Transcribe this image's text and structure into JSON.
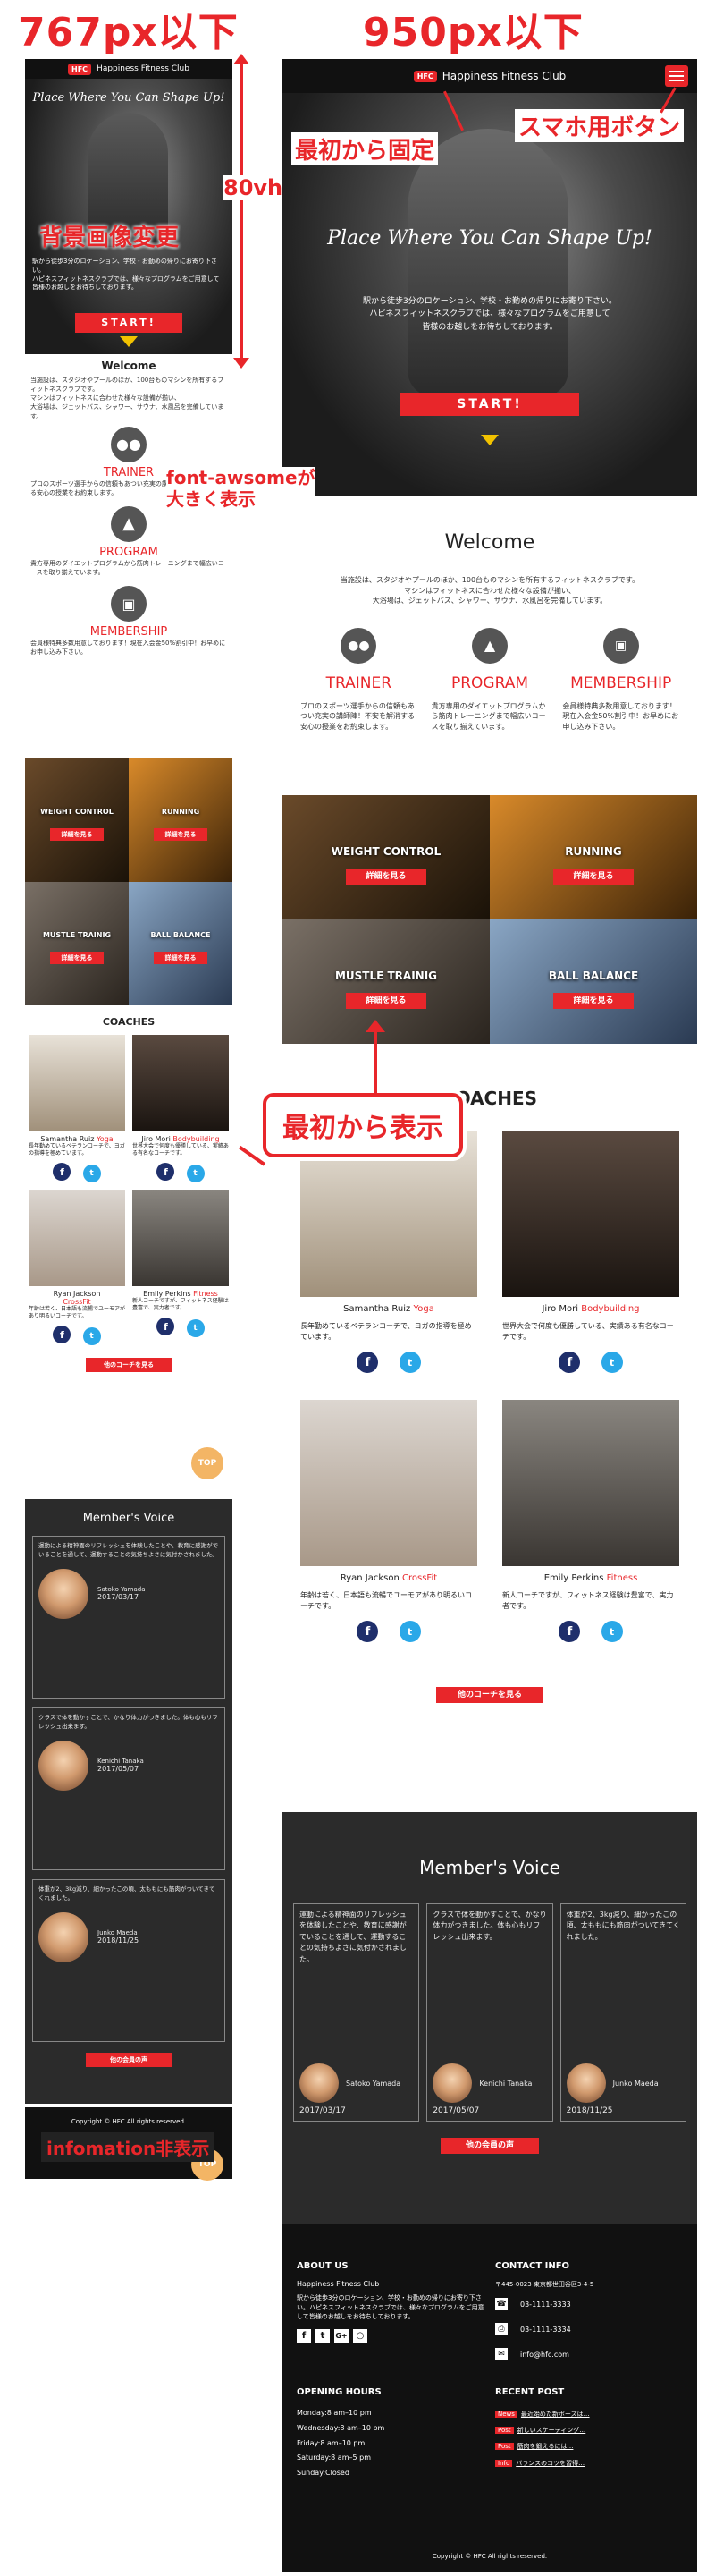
{
  "annotations": {
    "left_width": "767px以下",
    "right_width": "950px以下",
    "hero_height": "80vh",
    "bg_change": "背景画像変更",
    "fixed_header": "最初から固定",
    "sp_button": "スマホ用ボタン",
    "icon_large_1": "font-awsomeが",
    "icon_large_2": "大きく表示",
    "show_first": "最初から表示",
    "info_hidden": "infomation非表示"
  },
  "brand": {
    "badge": "HFC",
    "name": "Happiness Fitness Club"
  },
  "hero": {
    "tagline": "Place Where You Can Shape Up!",
    "text_1": "駅から徒歩3分のロケーション、学校・お勤めの帰りにお寄り下さい。",
    "text_2": "ハピネスフィットネスクラブでは、様々なプログラムをご用意して",
    "text_3": "皆様のお越しをお待ちしております。",
    "start": "START!"
  },
  "welcome": {
    "title": "Welcome",
    "text_1": "当施設は、スタジオやプールのほか、100台ものマシンを所有するフィットネスクラブです。",
    "text_2": "マシンはフィットネスに合わせた様々な設備が揃い、",
    "text_3": "大浴場は、ジェットバス、シャワー、サウナ、水風呂を完備しています。"
  },
  "features": [
    {
      "label": "TRAINER",
      "icon": "users-icon",
      "text": "プロのスポーツ選手からの信頼もあつい充実の講師陣！不安を解消する安心の授業をお約束します。"
    },
    {
      "label": "PROGRAM",
      "icon": "thumbs-up-icon",
      "text": "貴方専用のダイエットプログラムから筋肉トレーニングまで幅広いコースを取り揃えています。"
    },
    {
      "label": "MEMBERSHIP",
      "icon": "id-card-icon",
      "text": "会員様特典多数用意しております！現在入会金50%割引中！お早めにお申し込み下さい。"
    }
  ],
  "tiles": [
    {
      "label": "WEIGHT CONTROL",
      "button": "詳細を見る",
      "c1": "#6a4a2a",
      "c2": "#1a1208"
    },
    {
      "label": "RUNNING",
      "button": "詳細を見る",
      "c1": "#d98a2a",
      "c2": "#3a2208"
    },
    {
      "label": "MUSTLE TRAINIG",
      "button": "詳細を見る",
      "c1": "#7a7066",
      "c2": "#2a241e"
    },
    {
      "label": "BALL BALANCE",
      "button": "詳細を見る",
      "c1": "#8aa6c4",
      "c2": "#2a3a52"
    }
  ],
  "coaches_title": "COACHES",
  "coaches": [
    {
      "name": "Samantha Ruiz",
      "tag": "Yoga",
      "text": "長年勤めているベテランコーチで、ヨガの指導を極めています。",
      "c1": "#e8e2d8",
      "c2": "#a0907a"
    },
    {
      "name": "Jiro Mori",
      "tag": "Bodybuilding",
      "text": "世界大会で何度も優勝している、実績ある有名なコーチです。",
      "c1": "#5a4a40",
      "c2": "#1a1410"
    },
    {
      "name": "Ryan Jackson",
      "tag": "CrossFit",
      "text": "年齢は若く、日本語も流暢でユーモアがあり明るいコーチです。",
      "c1": "#dcd6d0",
      "c2": "#a89888"
    },
    {
      "name": "Emily Perkins",
      "tag": "Fitness",
      "text": "新人コーチですが、フィットネス経験は豊富で、実力者です。",
      "c1": "#8a8680",
      "c2": "#3a3632"
    }
  ],
  "coaches_more": "他のコーチを見る",
  "top_label": "TOP",
  "voice": {
    "title": "Member's Voice",
    "more": "他の会員の声",
    "items": [
      {
        "text": "運動による精神面のリフレッシュを体験したことや、教育に感謝がでいることを通して、運動することの気持ちよさに気付かされました。",
        "name": "Satoko Yamada",
        "date": "2017/03/17"
      },
      {
        "text": "クラスで体を動かすことで、かなり体力がつきました。体も心もリフレッシュ出来ます。",
        "name": "Kenichi Tanaka",
        "date": "2017/05/07"
      },
      {
        "text": "体重が2、3kg減り、細かったこの頃、太ももにも筋肉がついてきてくれました。",
        "name": "Junko Maeda",
        "date": "2018/11/25"
      }
    ]
  },
  "copyright": "Copyright © HFC All rights reserved.",
  "footer": {
    "about_title": "ABOUT US",
    "about_name": "Happiness Fitness Club",
    "about_text": "駅から徒歩3分のロケーション、学校・お勤めの帰りにお寄り下さい。ハピネスフィットネスクラブでは、様々なプログラムをご用意して皆様のお越しをお待ちしております。",
    "contact_title": "CONTACT INFO",
    "address": "〒445-0023 東京都世田谷区3-4-5",
    "tel": "03-1111-3333",
    "fax": "03-1111-3334",
    "mail": "info@hfc.com",
    "hours_title": "OPENING HOURS",
    "hours": [
      "Monday:8 am–10 pm",
      "Wednesday:8 am–10 pm",
      "Friday:8 am–10 pm",
      "Saturday:8 am–5 pm",
      "Sunday:Closed"
    ],
    "recent_title": "RECENT POST",
    "posts": [
      {
        "tag": "News",
        "text": "最近始めた新ボーズは…"
      },
      {
        "tag": "Post",
        "text": "新しいスケーティング…"
      },
      {
        "tag": "Post",
        "text": "筋肉を鍛えるには…"
      },
      {
        "tag": "Info",
        "text": "バランスのコツを習得…"
      }
    ],
    "copyright": "Copyright © HFC All rights reserved."
  },
  "colors": {
    "accent": "#e8262a",
    "dark": "#111111",
    "voice_bg": "#2b2b2b",
    "top_button": "#f3b565"
  }
}
